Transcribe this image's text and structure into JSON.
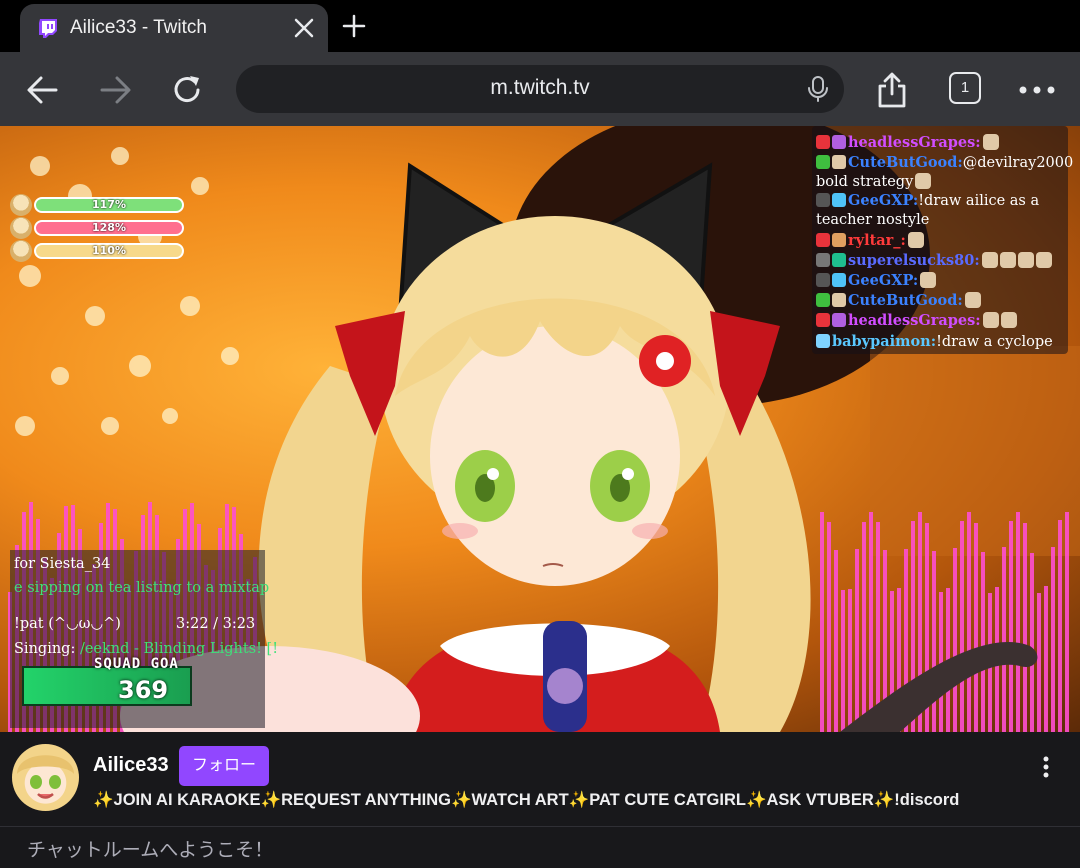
{
  "browser": {
    "tab_title": "Ailice33 - Twitch",
    "url": "m.twitch.tv",
    "tab_count": "1",
    "icons": [
      "twitch-favicon-icon",
      "close-icon",
      "plus-icon",
      "back-icon",
      "forward-icon",
      "reload-icon",
      "mic-icon",
      "share-icon",
      "menu-dots-icon"
    ]
  },
  "stream": {
    "hp_bars": [
      {
        "label": "117%",
        "color": "#7ee07a"
      },
      {
        "label": "128%",
        "color": "#ff6f8f"
      },
      {
        "label": "110%",
        "color": "#f7d98a"
      }
    ],
    "chat": [
      {
        "user": "headlessGrapes:",
        "user_color": "#d14dff",
        "message": ""
      },
      {
        "user": "CuteButGood:",
        "user_color": "#3b82ff",
        "message": "@devilray2000"
      },
      {
        "user": "",
        "user_color": "#ffffff",
        "message": "bold strategy"
      },
      {
        "user": "GeeGXP:",
        "user_color": "#3b82ff",
        "message": "!draw ailice as a"
      },
      {
        "user": "",
        "user_color": "#ffffff",
        "message": "teacher nostyle"
      },
      {
        "user": "ryltar_:",
        "user_color": "#ff3b3b",
        "message": ""
      },
      {
        "user": "superelsucks80:",
        "user_color": "#5a6bff",
        "message": ""
      },
      {
        "user": "GeeGXP:",
        "user_color": "#3b82ff",
        "message": ""
      },
      {
        "user": "CuteButGood:",
        "user_color": "#3b82ff",
        "message": ""
      },
      {
        "user": "headlessGrapes:",
        "user_color": "#d14dff",
        "message": ""
      },
      {
        "user": "babypaimon:",
        "user_color": "#5ac8ff",
        "message": "!draw a cyclope"
      }
    ],
    "song_panel": {
      "line1": "for Siesta_34",
      "line2": "e sipping on tea listing to a mixtap",
      "pat": "!pat (^◡ω◡^)",
      "time": "3:22 / 3:23",
      "singing_label": "Singing:",
      "singing_track": "/eeknd - Blinding Lights! [!",
      "squad_label": "SQUAD GOA",
      "squad_value": "369"
    }
  },
  "channel": {
    "name": "Ailice33",
    "follow_label": "フォロー",
    "title": "✨JOIN AI KARAOKE✨REQUEST ANYTHING✨WATCH ART✨PAT CUTE CATGIRL✨ASK VTUBER✨!discord",
    "accent": "#9147ff"
  },
  "chat_room": {
    "welcome": "チャットルームへようこそ！"
  }
}
